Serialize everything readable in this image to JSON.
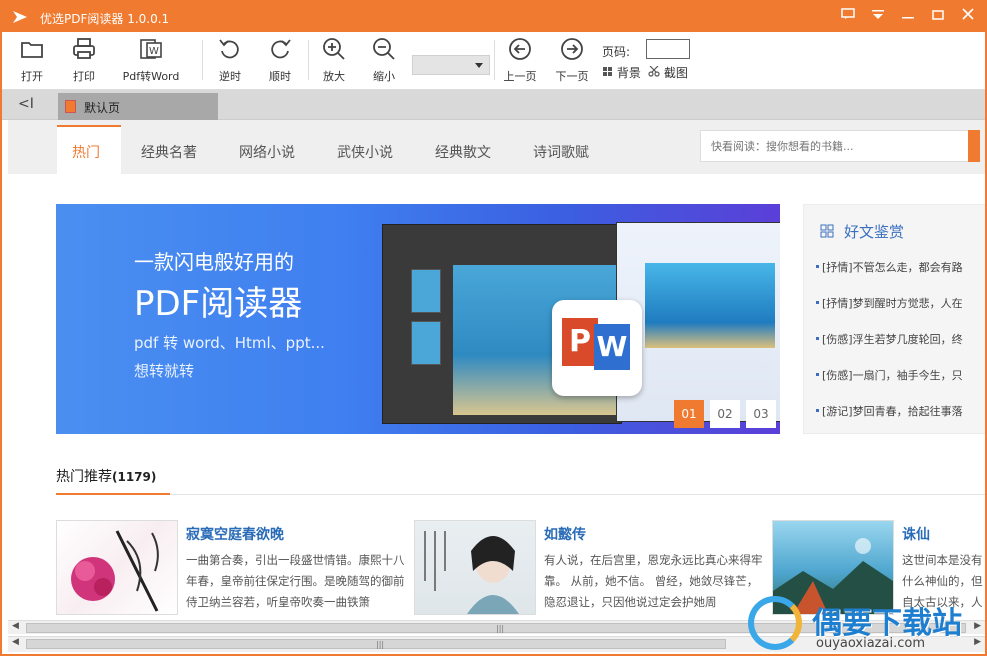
{
  "window": {
    "title": "优选PDF阅读器 1.0.0.1",
    "controls": [
      "feedback",
      "menu",
      "minimize",
      "maximize",
      "close"
    ]
  },
  "toolbar": {
    "open": "打开",
    "print": "打印",
    "pdf_to_word": "Pdf转Word",
    "undo": "逆时",
    "redo": "顺时",
    "zoom_in": "放大",
    "zoom_out": "缩小",
    "zoom_value": "",
    "prev_page": "上一页",
    "next_page": "下一页",
    "page_label": "页码:",
    "page_value": "",
    "background": "背景",
    "screenshot": "截图"
  },
  "tabs": {
    "back": "<I",
    "doc_tab": "默认页"
  },
  "categories": {
    "items": [
      "热门",
      "经典名著",
      "网络小说",
      "武侠小说",
      "经典散文",
      "诗词歌赋"
    ],
    "active_index": 0,
    "search_placeholder": "快看阅读：搜你想看的书籍..."
  },
  "banner": {
    "line1": "一款闪电般好用的",
    "line2": "PDF阅读器",
    "line3": "pdf 转 word、Html、ppt...",
    "line4": "想转就转",
    "dots": [
      "01",
      "02",
      "03"
    ],
    "active_dot": 0
  },
  "sidebar": {
    "heading": "好文鉴赏",
    "items": [
      "[抒情]不管怎么走，都会有路",
      "[抒情]梦到醒时方觉悲，人在",
      "[伤感]浮生若梦几度轮回，终",
      "[伤感]一扇门，袖手今生，只",
      "[游记]梦回青春，拾起往事落"
    ]
  },
  "recommend": {
    "title": "热门推荐",
    "count": "(1179)",
    "books": [
      {
        "title": "寂寞空庭春欲晚",
        "desc": "一曲第合奏，引出一段盛世情错。康熙十八年春，皇帝前往保定行围。是晚随驾的御前侍卫纳兰容若，听皇帝吹奏一曲铁箫"
      },
      {
        "title": "如懿传",
        "desc": "有人说，在后宫里，恩宠永远比真心来得牢靠。 从前，她不信。 曾经，她敛尽锋芒，隐忍退让，只因他说过定会护她周"
      },
      {
        "title": "诛仙",
        "desc": "这世间本是没有什么神仙的，但自太古以来，人类眼见周遭世界，诸般奇异之事，电闪雷鸣，狂风"
      }
    ]
  },
  "watermark": {
    "brand": "偶要下载站",
    "url": "ouyaoxiazai.com"
  },
  "colors": {
    "accent": "#f07a2f",
    "link": "#2a6cb8",
    "banner_blue": "#4a8ff0"
  }
}
